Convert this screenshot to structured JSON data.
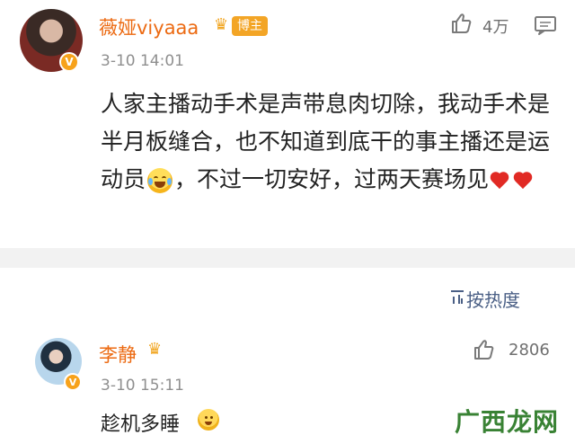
{
  "post": {
    "username": "薇娅viyaaa",
    "badge_label": "博主",
    "timestamp": "3-10 14:01",
    "like_count": "4万",
    "content_before_emoji": "人家主播动手术是声带息肉切除，我动手术是半月板缝合，也不知道到底干的事主播还是运动员",
    "content_after_emoji": "，不过一切安好，过两天赛场见",
    "icons": {
      "like": "thumb-up-icon",
      "comment": "comment-icon",
      "verified": "verified-icon",
      "crown": "crown-icon",
      "emoji_face": "laughing-crying-emoji-icon",
      "hearts": "heart-emoji-icon"
    },
    "accent_color": "#ec6a12"
  },
  "comments_header": {
    "sort_label": "按热度",
    "sort_icon": "sort-icon",
    "sort_color": "#4a5f85"
  },
  "reply": {
    "username": "李静",
    "timestamp": "3-10 15:11",
    "like_count": "2806",
    "text": "趁机多睡",
    "icons": {
      "like": "thumb-up-icon",
      "verified": "verified-icon",
      "crown": "crown-icon",
      "emoji": "drooling-emoji-icon"
    }
  },
  "watermark": {
    "text": "广西龙网"
  }
}
